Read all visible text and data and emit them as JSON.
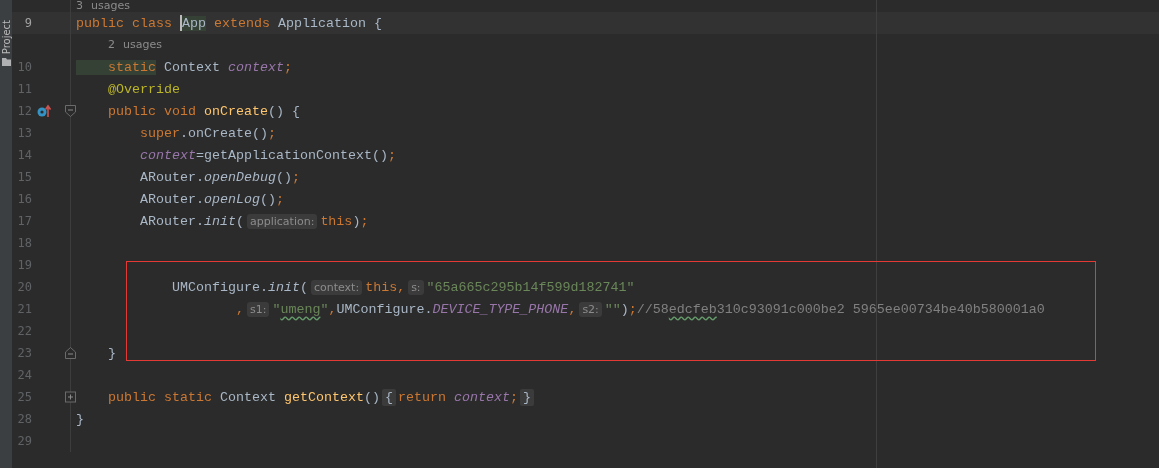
{
  "tool_strip": {
    "label": "Project"
  },
  "lines": [
    {
      "kind": "usages",
      "text": "3 usages"
    },
    {
      "kind": "code",
      "number": "9",
      "current": true,
      "segments": [
        {
          "kind": "code",
          "tokens": [
            {
              "kind": "keyword",
              "text": "public class "
            },
            {
              "kind": "plain",
              "text": "App",
              "highlighted": true,
              "caret": true
            },
            {
              "kind": "keyword",
              "text": " extends"
            },
            {
              "kind": "plain",
              "text": " Application {"
            }
          ]
        }
      ]
    },
    {
      "kind": "usages",
      "text": "    2 usages"
    },
    {
      "kind": "code",
      "number": "10",
      "current": false,
      "segments": [
        {
          "kind": "code",
          "tokens": [
            {
              "kind": "keyword",
              "text": "    static",
              "highlighted": true
            },
            {
              "kind": "plain",
              "text": " Context "
            },
            {
              "kind": "field",
              "text": "context"
            },
            {
              "kind": "keyword",
              "text": ";"
            }
          ]
        }
      ]
    },
    {
      "kind": "code",
      "number": "11",
      "current": false,
      "segments": [
        {
          "kind": "code",
          "tokens": [
            {
              "kind": "annotation",
              "text": "    @Override"
            }
          ]
        }
      ]
    },
    {
      "kind": "code",
      "number": "12",
      "current": false,
      "gutter": [
        {
          "kind": "override"
        },
        {
          "kind": "fold-start"
        }
      ],
      "segments": [
        {
          "kind": "code",
          "tokens": [
            {
              "kind": "keyword",
              "text": "    public void "
            },
            {
              "kind": "method",
              "text": "onCreate"
            },
            {
              "kind": "plain",
              "text": "() {"
            }
          ]
        }
      ]
    },
    {
      "kind": "code",
      "number": "13",
      "current": false,
      "segments": [
        {
          "kind": "code",
          "tokens": [
            {
              "kind": "keyword",
              "text": "        super"
            },
            {
              "kind": "plain",
              "text": ".onCreate()"
            },
            {
              "kind": "keyword",
              "text": ";"
            }
          ]
        }
      ]
    },
    {
      "kind": "code",
      "number": "14",
      "current": false,
      "segments": [
        {
          "kind": "code",
          "tokens": [
            {
              "kind": "field",
              "text": "        context"
            },
            {
              "kind": "plain",
              "text": "=getApplicationContext()"
            },
            {
              "kind": "keyword",
              "text": ";"
            }
          ]
        }
      ]
    },
    {
      "kind": "code",
      "number": "15",
      "current": false,
      "segments": [
        {
          "kind": "code",
          "tokens": [
            {
              "kind": "plain",
              "text": "        ARouter."
            },
            {
              "kind": "static",
              "text": "openDebug"
            },
            {
              "kind": "plain",
              "text": "()"
            },
            {
              "kind": "keyword",
              "text": ";"
            }
          ]
        }
      ]
    },
    {
      "kind": "code",
      "number": "16",
      "current": false,
      "segments": [
        {
          "kind": "code",
          "tokens": [
            {
              "kind": "plain",
              "text": "        ARouter."
            },
            {
              "kind": "static",
              "text": "openLog"
            },
            {
              "kind": "plain",
              "text": "()"
            },
            {
              "kind": "keyword",
              "text": ";"
            }
          ]
        }
      ]
    },
    {
      "kind": "code",
      "number": "17",
      "current": false,
      "segments": [
        {
          "kind": "code",
          "tokens": [
            {
              "kind": "plain",
              "text": "        ARouter."
            },
            {
              "kind": "static",
              "text": "init"
            },
            {
              "kind": "plain",
              "text": "("
            }
          ]
        },
        {
          "kind": "hint",
          "text": "application:"
        },
        {
          "kind": "code",
          "tokens": [
            {
              "kind": "keyword",
              "text": "this"
            },
            {
              "kind": "plain",
              "text": ")"
            },
            {
              "kind": "keyword",
              "text": ";"
            }
          ]
        }
      ]
    },
    {
      "kind": "code",
      "number": "18",
      "current": false
    },
    {
      "kind": "code",
      "number": "19",
      "current": false
    },
    {
      "kind": "code",
      "number": "20",
      "current": false,
      "segments": [
        {
          "kind": "code",
          "tokens": [
            {
              "kind": "plain",
              "text": "            UMConfigure."
            },
            {
              "kind": "static",
              "text": "init"
            },
            {
              "kind": "plain",
              "text": "("
            }
          ]
        },
        {
          "kind": "hint",
          "text": "context:"
        },
        {
          "kind": "code",
          "tokens": [
            {
              "kind": "keyword",
              "text": "this,"
            }
          ]
        },
        {
          "kind": "hint",
          "text": "s:"
        },
        {
          "kind": "code",
          "tokens": [
            {
              "kind": "string",
              "text": "\"65a665c295b14f599d182741\""
            }
          ]
        }
      ]
    },
    {
      "kind": "code",
      "number": "21",
      "current": false,
      "segments": [
        {
          "kind": "code",
          "tokens": [
            {
              "kind": "keyword",
              "text": "                    ,"
            }
          ]
        },
        {
          "kind": "hint",
          "text": "s1:"
        },
        {
          "kind": "code",
          "tokens": [
            {
              "kind": "string",
              "text": "\""
            },
            {
              "kind": "string",
              "text": "umeng",
              "typo": true
            },
            {
              "kind": "string",
              "text": "\""
            },
            {
              "kind": "keyword",
              "text": ","
            },
            {
              "kind": "plain",
              "text": "UMConfigure."
            },
            {
              "kind": "constant",
              "text": "DEVICE_TYPE_PHONE"
            },
            {
              "kind": "keyword",
              "text": ","
            }
          ]
        },
        {
          "kind": "hint",
          "text": "s2:"
        },
        {
          "kind": "code",
          "tokens": [
            {
              "kind": "string",
              "text": "\"\""
            },
            {
              "kind": "plain",
              "text": ")"
            },
            {
              "kind": "keyword",
              "text": ";"
            },
            {
              "kind": "comment",
              "text": "//58"
            },
            {
              "kind": "comment",
              "text": "edcfeb",
              "typo": true
            },
            {
              "kind": "comment",
              "text": "310c93091c000be2 5965ee00734be40b580001a0"
            }
          ]
        }
      ]
    },
    {
      "kind": "code",
      "number": "22",
      "current": false
    },
    {
      "kind": "code",
      "number": "23",
      "current": false,
      "gutter": [
        {
          "kind": "fold-end"
        }
      ],
      "segments": [
        {
          "kind": "code",
          "tokens": [
            {
              "kind": "plain",
              "text": "    }"
            }
          ]
        }
      ]
    },
    {
      "kind": "code",
      "number": "24",
      "current": false
    },
    {
      "kind": "code",
      "number": "25",
      "current": false,
      "gutter": [
        {
          "kind": "fold-collapsed"
        }
      ],
      "segments": [
        {
          "kind": "code",
          "tokens": [
            {
              "kind": "keyword",
              "text": "    public static "
            },
            {
              "kind": "plain",
              "text": "Context "
            },
            {
              "kind": "method",
              "text": "getContext"
            },
            {
              "kind": "plain",
              "text": "()"
            }
          ]
        },
        {
          "kind": "folded",
          "text": "{"
        },
        {
          "kind": "code",
          "tokens": [
            {
              "kind": "keyword",
              "text": "return "
            },
            {
              "kind": "field",
              "text": "context"
            },
            {
              "kind": "keyword",
              "text": ";"
            }
          ]
        },
        {
          "kind": "folded",
          "text": "}"
        }
      ]
    },
    {
      "kind": "code",
      "number": "28",
      "current": false,
      "segments": [
        {
          "kind": "code",
          "tokens": [
            {
              "kind": "plain",
              "text": "}"
            }
          ]
        }
      ]
    },
    {
      "kind": "code",
      "number": "29",
      "current": false
    }
  ]
}
